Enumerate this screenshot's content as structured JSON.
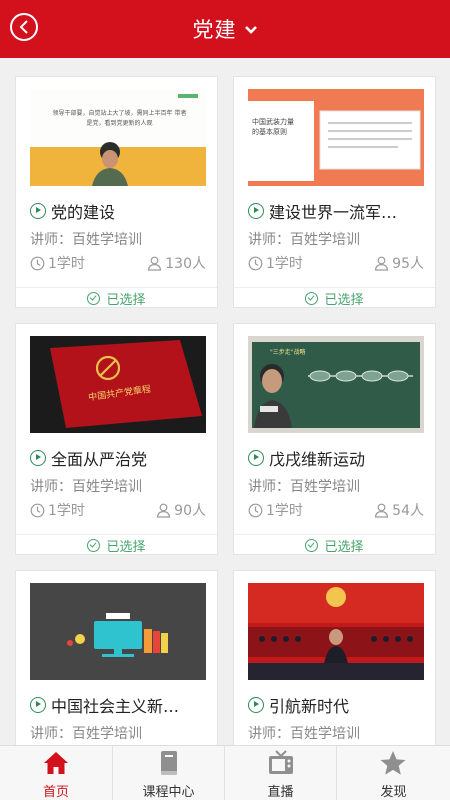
{
  "header": {
    "title": "党建"
  },
  "courses": [
    {
      "title": "党的建设",
      "teacher": "讲师：百姓学培训",
      "hours": "1学时",
      "people": "130人",
      "status": "已选择",
      "thumb_text": "领导干部要，自觉站上大了坡，需同上半百年 带者是党，看到党更新的人观"
    },
    {
      "title": "建设世界一流军…",
      "teacher": "讲师：百姓学培训",
      "hours": "1学时",
      "people": "95人",
      "status": "已选择",
      "thumb_text": "中国武装力量的基本原则"
    },
    {
      "title": "全面从严治党",
      "teacher": "讲师：百姓学培训",
      "hours": "1学时",
      "people": "90人",
      "status": "已选择",
      "thumb_text": "中国共产党章程"
    },
    {
      "title": "戊戌维新运动",
      "teacher": "讲师：百姓学培训",
      "hours": "1学时",
      "people": "54人",
      "status": "已选择",
      "thumb_text": "\"三步走\"战略"
    },
    {
      "title": "中国社会主义新…",
      "teacher": "讲师：百姓学培训",
      "hours": "",
      "people": "",
      "status": "",
      "thumb_text": ""
    },
    {
      "title": "引航新时代",
      "teacher": "讲师：百姓学培训",
      "hours": "",
      "people": "",
      "status": "",
      "thumb_text": ""
    }
  ],
  "tabs": [
    {
      "label": "首页",
      "icon": "home-icon",
      "active": true
    },
    {
      "label": "课程中心",
      "icon": "book-icon",
      "active": false
    },
    {
      "label": "直播",
      "icon": "tv-icon",
      "active": false
    },
    {
      "label": "发现",
      "icon": "star-icon",
      "active": false
    }
  ],
  "colors": {
    "brand": "#d3111c",
    "selected": "#49a36d",
    "play": "#2e8b57"
  }
}
